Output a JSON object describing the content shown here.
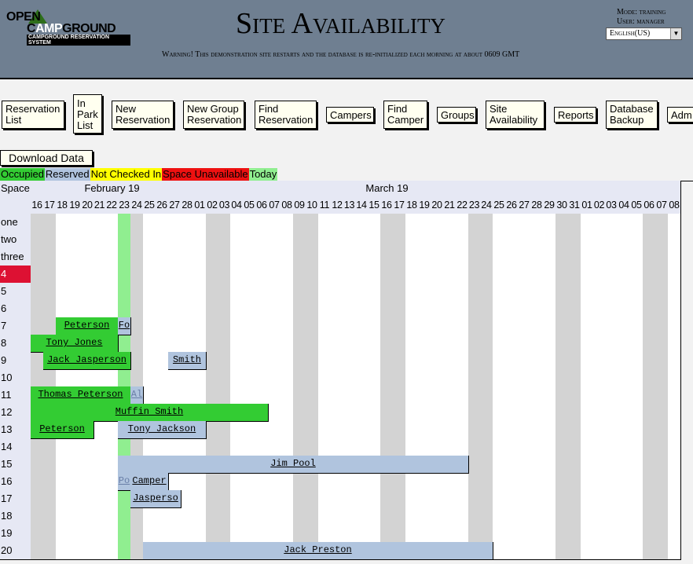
{
  "header": {
    "logo_line1": "OPEN",
    "logo_line2a": "C",
    "logo_line2b": "AMP",
    "logo_line2c": "GROUND",
    "logo_line3": "CAMPGROUND RESERVATION SYSTEM",
    "title": "Site Availability",
    "warning": "Warning! This demonstration site restarts and the database is re-initialized each morning at about 0609 GMT",
    "mode": "Mode: training",
    "user": "User: manager",
    "language": "English(US)"
  },
  "nav": [
    {
      "label": "Reservation\nList"
    },
    {
      "label": "In\nPark\nList"
    },
    {
      "label": "New\nReservation"
    },
    {
      "label": "New Group\nReservation"
    },
    {
      "label": "Find\nReservation"
    },
    {
      "label": "Campers"
    },
    {
      "label": "Find\nCamper"
    },
    {
      "label": "Groups"
    },
    {
      "label": "Site\nAvailability"
    },
    {
      "label": "Reports"
    },
    {
      "label": "Database\nBackup"
    },
    {
      "label": "Adm"
    }
  ],
  "download_label": "Download Data",
  "legend": [
    {
      "label": "Occupied",
      "color": "#33cc33"
    },
    {
      "label": "Reserved",
      "color": "#b0c4de"
    },
    {
      "label": "Not Checked In",
      "color": "#ffff00"
    },
    {
      "label": "Space Unavailable",
      "color": "#ee1111"
    },
    {
      "label": "Today",
      "color": "#90ee90"
    }
  ],
  "grid": {
    "space_header": "Space",
    "months": [
      {
        "label": "February 19",
        "days": 13
      },
      {
        "label": "March 19",
        "days": 31
      },
      {
        "label": "",
        "days": 8
      }
    ],
    "days": [
      "16",
      "17",
      "18",
      "19",
      "20",
      "21",
      "22",
      "23",
      "24",
      "25",
      "26",
      "27",
      "28",
      "01",
      "02",
      "03",
      "04",
      "05",
      "06",
      "07",
      "08",
      "09",
      "10",
      "11",
      "12",
      "13",
      "14",
      "15",
      "16",
      "17",
      "18",
      "19",
      "20",
      "21",
      "22",
      "23",
      "24",
      "25",
      "26",
      "27",
      "28",
      "29",
      "30",
      "31",
      "01",
      "02",
      "03",
      "04",
      "05",
      "06",
      "07",
      "08"
    ],
    "weekend_cols": [
      0,
      1,
      7,
      8,
      14,
      15,
      21,
      22,
      28,
      29,
      35,
      36,
      42,
      43,
      49,
      50
    ],
    "today_col": 7,
    "spaces": [
      "one",
      "two",
      "three",
      "4",
      "5",
      "6",
      "7",
      "8",
      "9",
      "10",
      "11",
      "12",
      "13",
      "14",
      "15",
      "16",
      "17",
      "18",
      "19",
      "20"
    ],
    "unavailable_spaces": [
      "4"
    ],
    "bookings": [
      {
        "space": "7",
        "start": 2,
        "end": 7,
        "name": "Peterson",
        "status": "occupied"
      },
      {
        "space": "7",
        "start": 7,
        "end": 8,
        "name": "Fo",
        "status": "reserved"
      },
      {
        "space": "8",
        "start": 0,
        "end": 7,
        "name": "Tony Jones",
        "status": "occupied"
      },
      {
        "space": "9",
        "start": 1,
        "end": 8,
        "name": "Jack Jasperson",
        "status": "occupied"
      },
      {
        "space": "9",
        "start": 11,
        "end": 14,
        "name": "Smith",
        "status": "reserved"
      },
      {
        "space": "11",
        "start": 0,
        "end": 8,
        "name": "Thomas Peterson",
        "status": "occupied"
      },
      {
        "space": "11",
        "start": 8,
        "end": 9,
        "name": "Al",
        "status": "reserved_faded"
      },
      {
        "space": "12",
        "start": 0,
        "end": 19,
        "name": "Muffin Smith",
        "status": "occupied"
      },
      {
        "space": "13",
        "start": 0,
        "end": 5,
        "name": "Peterson",
        "status": "occupied"
      },
      {
        "space": "13",
        "start": 7,
        "end": 14,
        "name": "Tony Jackson",
        "status": "reserved"
      },
      {
        "space": "15",
        "start": 7,
        "end": 35,
        "name": "Jim Pool",
        "status": "reserved"
      },
      {
        "space": "16",
        "start": 7,
        "end": 8,
        "name": "Po",
        "status": "reserved_faded"
      },
      {
        "space": "16",
        "start": 8,
        "end": 11,
        "name": "Camper",
        "status": "reserved"
      },
      {
        "space": "17",
        "start": 8,
        "end": 12,
        "name": "Jasperso",
        "status": "reserved"
      },
      {
        "space": "20",
        "start": 9,
        "end": 37,
        "name": "Jack Preston",
        "status": "reserved"
      }
    ]
  },
  "colors": {
    "occupied": "#33cc33",
    "reserved": "#b0c4de",
    "today": "#90ee90",
    "weekend": "#d3d3d3",
    "unavailable": "#dd1133",
    "header_bg": "#6f7f91"
  }
}
